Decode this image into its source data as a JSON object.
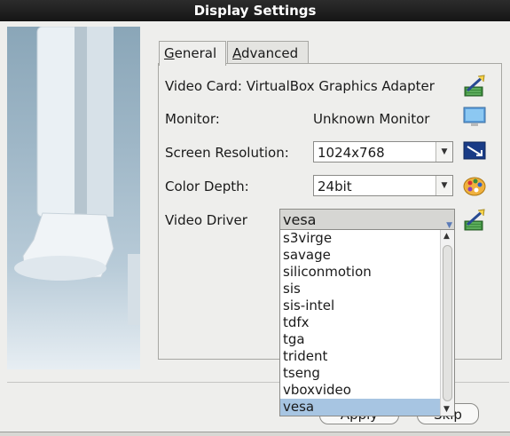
{
  "window": {
    "title": "Display Settings"
  },
  "tabs": [
    {
      "label_prefix": "G",
      "label_rest": "eneral",
      "active": true
    },
    {
      "label_prefix": "A",
      "label_rest": "dvanced",
      "active": false
    }
  ],
  "general": {
    "video_card": {
      "label": "Video Card:",
      "value": "VirtualBox Graphics Adapter",
      "icon": "configure-wizard-icon"
    },
    "monitor": {
      "label": "Monitor:",
      "value": "Unknown Monitor",
      "icon": "monitor-icon"
    },
    "screen_resolution": {
      "label": "Screen Resolution:",
      "value": "1024x768",
      "icon": "screen-preview-icon"
    },
    "color_depth": {
      "label": "Color Depth:",
      "value": "24bit",
      "icon": "color-palette-icon"
    },
    "video_driver": {
      "label": "Video Driver",
      "value": "vesa",
      "icon": "configure-wizard-icon"
    }
  },
  "driver_list": {
    "items": [
      "s3virge",
      "savage",
      "siliconmotion",
      "sis",
      "sis-intel",
      "tdfx",
      "tga",
      "trident",
      "tseng",
      "vboxvideo",
      "vesa"
    ],
    "selected": "vesa"
  },
  "buttons": {
    "apply_label": "Apply",
    "skip_label": "Skip"
  }
}
